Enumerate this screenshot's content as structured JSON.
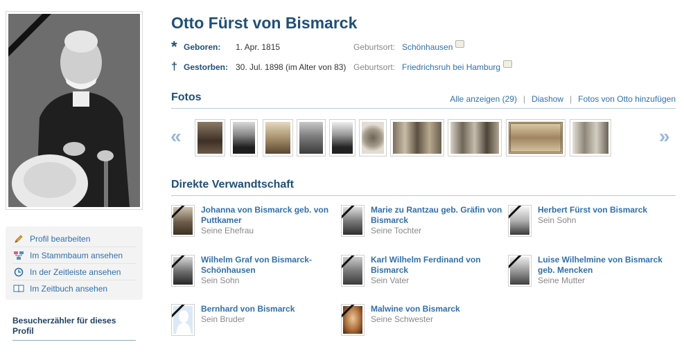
{
  "profile": {
    "name": "Otto Fürst von Bismarck",
    "born": {
      "label": "Geboren:",
      "symbol": "*",
      "date": "1. Apr. 1815",
      "place_label": "Geburtsort:",
      "place": "Schönhausen"
    },
    "died": {
      "label": "Gestorben:",
      "symbol": "†",
      "date": "30. Jul. 1898 (im Alter von 83)",
      "place_label": "Geburtsort:",
      "place": "Friedrichsruh bei Hamburg"
    }
  },
  "actions": [
    {
      "label": "Profil bearbeiten",
      "icon": "pencil-icon"
    },
    {
      "label": "Im Stammbaum ansehen",
      "icon": "family-tree-icon"
    },
    {
      "label": "In der Zeitleiste ansehen",
      "icon": "timeline-icon"
    },
    {
      "label": "Im Zeitbuch ansehen",
      "icon": "book-icon"
    }
  ],
  "visitor": {
    "title": "Besucherzähler für dieses Profil"
  },
  "photos": {
    "title": "Fotos",
    "links": {
      "all": "Alle anzeigen (29)",
      "slideshow": "Diashow",
      "add": "Fotos von Otto hinzufügen",
      "separator": "|"
    },
    "prev": "«",
    "next": "»"
  },
  "relatives": {
    "title": "Direkte Verwandtschaft",
    "items": [
      {
        "name": "Johanna von Bismarck geb. von Puttkamer",
        "role": "Seine Ehefrau"
      },
      {
        "name": "Marie zu Rantzau geb. Gräfin von Bismarck",
        "role": "Seine Tochter"
      },
      {
        "name": "Herbert Fürst von Bismarck",
        "role": "Sein Sohn"
      },
      {
        "name": "Wilhelm Graf von Bismarck-Schönhausen",
        "role": "Sein Sohn"
      },
      {
        "name": "Karl Wilhelm Ferdinand von Bismarck",
        "role": "Sein Vater"
      },
      {
        "name": "Luise Wilhelmine von Bismarck geb. Mencken",
        "role": "Seine Mutter"
      },
      {
        "name": "Bernhard von Bismarck",
        "role": "Sein Bruder"
      },
      {
        "name": "Malwine von Bismarck",
        "role": "Seine Schwester"
      }
    ]
  },
  "colors": {
    "heading": "#1e4f7a",
    "link": "#2f6fb0",
    "muted": "#888888"
  }
}
